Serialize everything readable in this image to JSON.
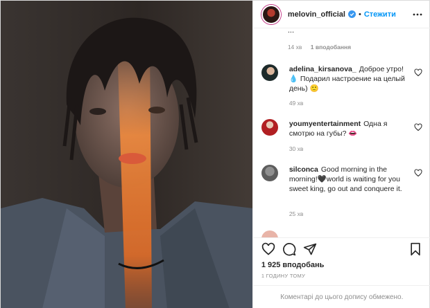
{
  "header": {
    "username": "melovin_official",
    "separator": "•",
    "follow_label": "Стежити"
  },
  "prev_comment": {
    "cut_text": "...",
    "time": "14 хв",
    "likes": "1 вподобання"
  },
  "comments": [
    {
      "user": "adelina_kirsanova_",
      "text": "Доброе утро! 💧 Подарил настроение на целый день) 🙂",
      "time": "49 хв"
    },
    {
      "user": "youmyentertainment",
      "text": "Одна я смотрю на губы? 👄",
      "time": "30 хв"
    },
    {
      "user": "silconca",
      "text": "Good morning in the morning!🖤world is waiting for you sweet king, go out and conquere it.",
      "time": "25 хв"
    }
  ],
  "post": {
    "likes": "1 925 вподобань",
    "time": "1 ГОДИНУ ТОМУ",
    "footer": "Коментарі до цього допису обмежено."
  },
  "icons": {
    "verified": "verified-badge-icon",
    "more": "more-options-icon",
    "heart": "heart-icon",
    "comment": "comment-icon",
    "share": "share-icon",
    "save": "bookmark-icon"
  },
  "colors": {
    "link": "#0095f6",
    "secondary_text": "#8e8e8e",
    "verified": "#3897f0"
  }
}
